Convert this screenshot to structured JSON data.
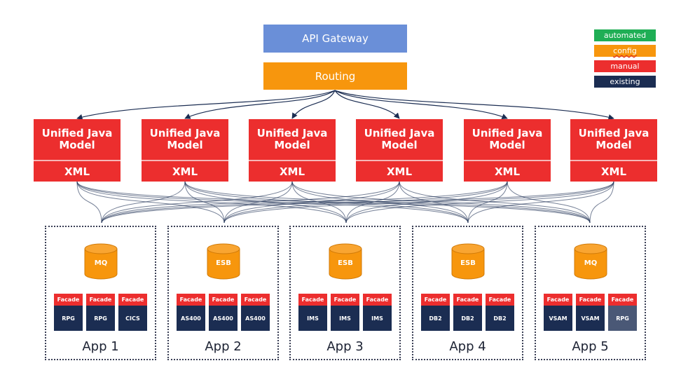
{
  "gateway": {
    "label": "API Gateway",
    "color": "#6a8fd8"
  },
  "routing": {
    "label": "Routing",
    "color": "#f7960d"
  },
  "legend": [
    {
      "label": "automated",
      "color": "#1fae55"
    },
    {
      "label": "config",
      "color": "#f7960d"
    },
    {
      "label": "manual",
      "color": "#ec2e2e"
    },
    {
      "label": "existing",
      "color": "#1b2d52"
    }
  ],
  "models": [
    {
      "title": "Unified Java Model",
      "format": "XML"
    },
    {
      "title": "Unified Java Model",
      "format": "XML"
    },
    {
      "title": "Unified Java Model",
      "format": "XML"
    },
    {
      "title": "Unified Java Model",
      "format": "XML"
    },
    {
      "title": "Unified Java Model",
      "format": "XML"
    },
    {
      "title": "Unified Java Model",
      "format": "XML"
    }
  ],
  "apps": [
    {
      "name": "App 1",
      "middleware": "MQ",
      "facades": [
        {
          "facade": "Facade",
          "system": "RPG"
        },
        {
          "facade": "Facade",
          "system": "RPG"
        },
        {
          "facade": "Facade",
          "system": "CICS"
        }
      ]
    },
    {
      "name": "App 2",
      "middleware": "ESB",
      "facades": [
        {
          "facade": "Facade",
          "system": "AS400"
        },
        {
          "facade": "Facade",
          "system": "AS400"
        },
        {
          "facade": "Facade",
          "system": "AS400"
        }
      ]
    },
    {
      "name": "App 3",
      "middleware": "ESB",
      "facades": [
        {
          "facade": "Facade",
          "system": "IMS"
        },
        {
          "facade": "Facade",
          "system": "IMS"
        },
        {
          "facade": "Facade",
          "system": "IMS"
        }
      ]
    },
    {
      "name": "App 4",
      "middleware": "ESB",
      "facades": [
        {
          "facade": "Facade",
          "system": "DB2"
        },
        {
          "facade": "Facade",
          "system": "DB2"
        },
        {
          "facade": "Facade",
          "system": "DB2"
        }
      ]
    },
    {
      "name": "App 5",
      "middleware": "MQ",
      "facades": [
        {
          "facade": "Facade",
          "system": "VSAM"
        },
        {
          "facade": "Facade",
          "system": "VSAM"
        },
        {
          "facade": "Facade",
          "system": "RPG",
          "faded": true
        }
      ]
    }
  ],
  "connections": {
    "routing_to_models": "all",
    "models_to_apps": "full-mesh"
  },
  "colors": {
    "edge": "#1b2d52",
    "cylinder": "#f7960d",
    "cylinder_stroke": "#d07a08"
  }
}
